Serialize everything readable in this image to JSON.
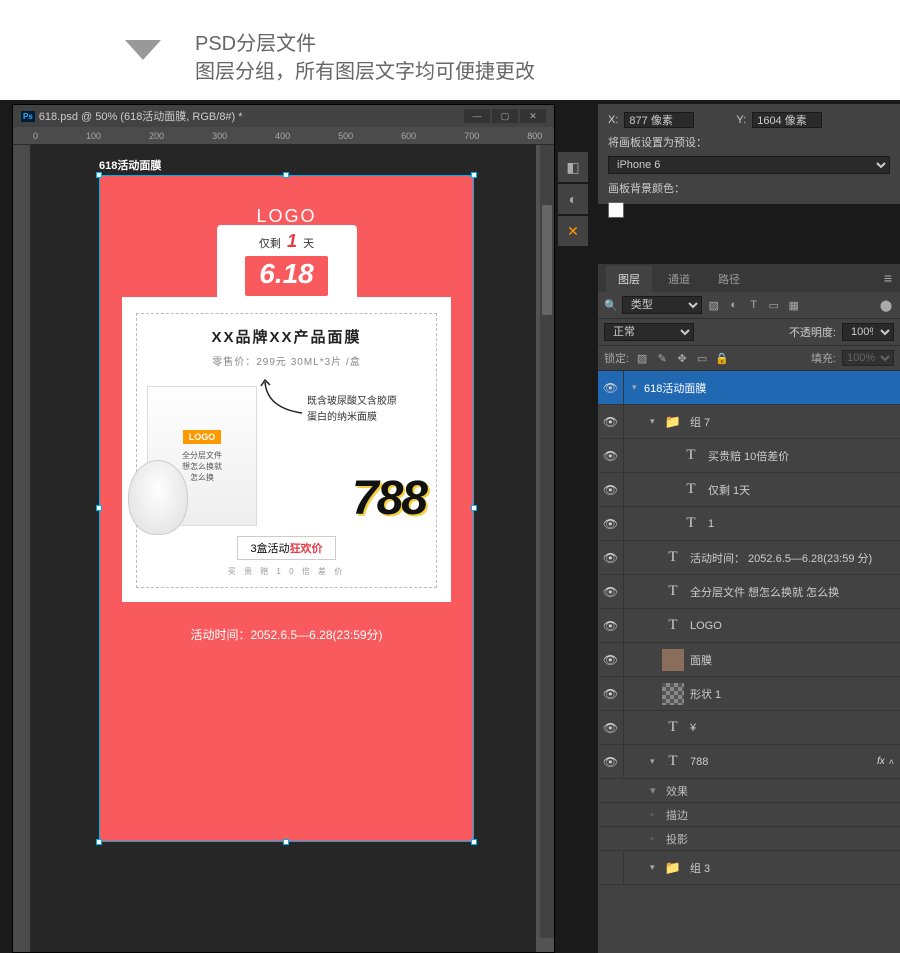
{
  "header": {
    "line1": "PSD分层文件",
    "line2": "图层分组，所有图层文字均可便捷更改"
  },
  "doc": {
    "title": "618.psd @ 50% (618活动面膜, RGB/8#) *",
    "ruler_marks": [
      "0",
      "100",
      "200",
      "300",
      "400",
      "500",
      "600",
      "700",
      "800"
    ]
  },
  "artboard": {
    "label": "618活动面膜",
    "logo": "LOGO",
    "remain_prefix": "仅剩",
    "remain_num": "1",
    "remain_suffix": "天",
    "date": "6.18",
    "product_title": "XX品牌XX产品面膜",
    "product_sub": "零售价：299元  30ML*3片 /盒",
    "pkg_logo": "LOGO",
    "pkg_line1": "全分层文件",
    "pkg_line2": "想怎么换就",
    "pkg_line3": "怎么换",
    "desc1": "既含玻尿酸又含胶原",
    "desc2": "蛋白的纳米面膜",
    "price": "788",
    "deal_prefix": "3盒活动",
    "deal_red": "狂欢价",
    "guarantee": "买 贵 赔 1 0 倍 差 价",
    "bottom": "活动时间：2052.6.5—6.28(23:59分)"
  },
  "props": {
    "x_label": "X:",
    "x_val": "877 像素",
    "y_label": "Y:",
    "y_val": "1604 像素",
    "preset_label": "将画板设置为预设：",
    "preset_val": "iPhone 6",
    "bg_label": "画板背景颜色："
  },
  "panel": {
    "tabs": [
      "图层",
      "通道",
      "路径"
    ],
    "filter_label": "类型",
    "blend": "正常",
    "opacity_label": "不透明度:",
    "opacity_val": "100%",
    "lock_label": "锁定:",
    "fill_label": "填充:",
    "fill_val": "100%"
  },
  "layers": [
    {
      "eye": true,
      "depth": 0,
      "twist": "▾",
      "icon": "",
      "name": "618活动面膜",
      "sel": true
    },
    {
      "eye": true,
      "depth": 1,
      "twist": "▾",
      "icon": "fold",
      "name": "组 7"
    },
    {
      "eye": true,
      "depth": 2,
      "twist": "",
      "icon": "T",
      "name": "买贵赔 10倍差价"
    },
    {
      "eye": true,
      "depth": 2,
      "twist": "",
      "icon": "T",
      "name": "仅剩 1天"
    },
    {
      "eye": true,
      "depth": 2,
      "twist": "",
      "icon": "T",
      "name": "1"
    },
    {
      "eye": true,
      "depth": 1,
      "twist": "",
      "icon": "T",
      "name": "活动时间： 2052.6.5—6.28(23:59 分)"
    },
    {
      "eye": true,
      "depth": 1,
      "twist": "",
      "icon": "T",
      "name": "全分层文件 想怎么换就 怎么换"
    },
    {
      "eye": true,
      "depth": 1,
      "twist": "",
      "icon": "T",
      "name": "LOGO"
    },
    {
      "eye": true,
      "depth": 1,
      "twist": "",
      "icon": "img",
      "name": "面膜"
    },
    {
      "eye": true,
      "depth": 1,
      "twist": "",
      "icon": "checker",
      "name": "形状 1"
    },
    {
      "eye": true,
      "depth": 1,
      "twist": "",
      "icon": "T",
      "name": "¥"
    },
    {
      "eye": true,
      "depth": 1,
      "twist": "▾",
      "icon": "T",
      "name": "788",
      "fx": true
    },
    {
      "eye": false,
      "depth": 1,
      "twist": "▾",
      "icon": "fold",
      "name": "组 3"
    }
  ],
  "fx": {
    "label": "效果",
    "items": [
      "描边",
      "投影"
    ]
  }
}
